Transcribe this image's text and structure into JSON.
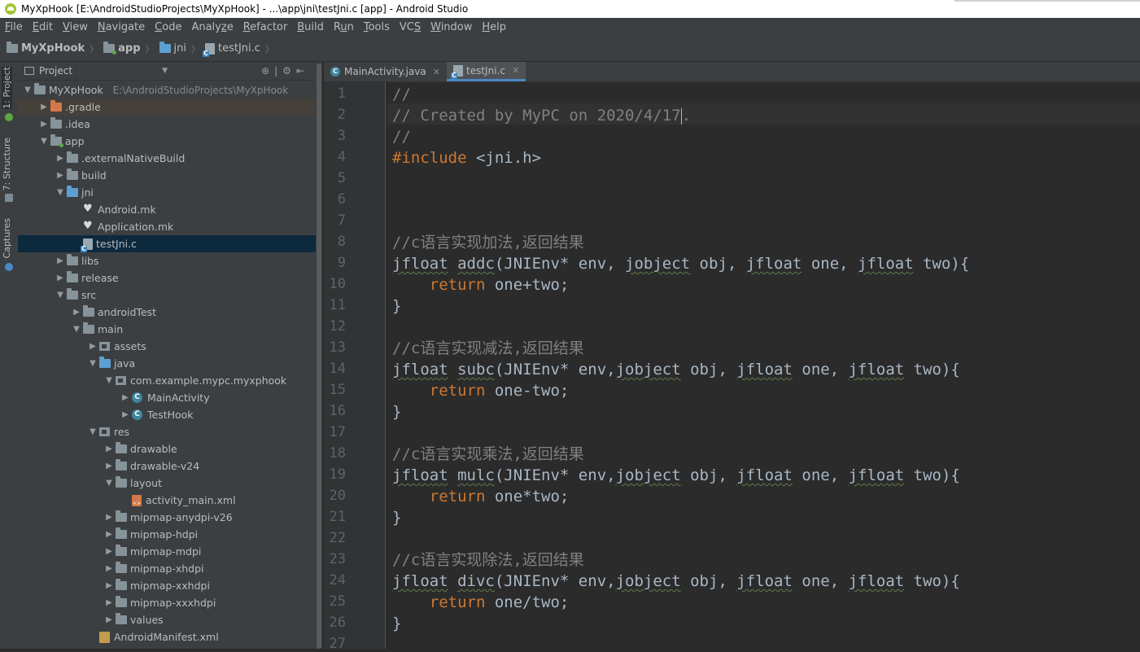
{
  "title": "MyXpHook [E:\\AndroidStudioProjects\\MyXpHook] - ...\\app\\jni\\testJni.c [app] - Android Studio",
  "menu": [
    {
      "key": "F",
      "rest": "ile"
    },
    {
      "key": "E",
      "rest": "dit"
    },
    {
      "key": "V",
      "rest": "iew"
    },
    {
      "key": "N",
      "rest": "avigate"
    },
    {
      "key": "C",
      "rest": "ode"
    },
    {
      "key": "",
      "rest": "Analy",
      "key2": "z",
      "rest2": "e"
    },
    {
      "key": "R",
      "rest": "efactor"
    },
    {
      "key": "B",
      "rest": "uild"
    },
    {
      "key": "",
      "rest": "R",
      "key2": "u",
      "rest2": "n"
    },
    {
      "key": "T",
      "rest": "ools"
    },
    {
      "key": "",
      "rest": "VC",
      "key2": "S",
      "rest2": ""
    },
    {
      "key": "W",
      "rest": "indow"
    },
    {
      "key": "H",
      "rest": "elp"
    }
  ],
  "breadcrumb": [
    "MyXpHook",
    "app",
    "jni",
    "testJni.c"
  ],
  "tool_windows": {
    "project": "1: Project",
    "structure": "7: Structure",
    "captures": "Captures"
  },
  "project_panel": {
    "title": "Project",
    "root_label": "MyXpHook",
    "root_path": "E:\\AndroidStudioProjects\\MyXpHook",
    "tree": [
      {
        "label": ".gradle"
      },
      {
        "label": ".idea"
      },
      {
        "label": "app"
      },
      {
        "label": ".externalNativeBuild"
      },
      {
        "label": "build"
      },
      {
        "label": "jni"
      },
      {
        "label": "Android.mk"
      },
      {
        "label": "Application.mk"
      },
      {
        "label": "testJni.c"
      },
      {
        "label": "libs"
      },
      {
        "label": "release"
      },
      {
        "label": "src"
      },
      {
        "label": "androidTest"
      },
      {
        "label": "main"
      },
      {
        "label": "assets"
      },
      {
        "label": "java"
      },
      {
        "label": "com.example.mypc.myxphook"
      },
      {
        "label": "MainActivity"
      },
      {
        "label": "TestHook"
      },
      {
        "label": "res"
      },
      {
        "label": "drawable"
      },
      {
        "label": "drawable-v24"
      },
      {
        "label": "layout"
      },
      {
        "label": "activity_main.xml"
      },
      {
        "label": "mipmap-anydpi-v26"
      },
      {
        "label": "mipmap-hdpi"
      },
      {
        "label": "mipmap-mdpi"
      },
      {
        "label": "mipmap-xhdpi"
      },
      {
        "label": "mipmap-xxhdpi"
      },
      {
        "label": "mipmap-xxxhdpi"
      },
      {
        "label": "values"
      },
      {
        "label": "AndroidManifest.xml"
      }
    ]
  },
  "tabs": [
    {
      "label": "MainActivity.java",
      "active": false
    },
    {
      "label": "testJni.c",
      "active": true
    }
  ],
  "editor": {
    "line_numbers": [
      "1",
      "2",
      "3",
      "4",
      "5",
      "6",
      "7",
      "8",
      "9",
      "10",
      "11",
      "12",
      "13",
      "14",
      "15",
      "16",
      "17",
      "18",
      "19",
      "20",
      "21",
      "22",
      "23",
      "24",
      "25",
      "26",
      "27"
    ],
    "comments": {
      "l1": "//",
      "l2a": "// Created by MyPC on 2020/4/17",
      "l2b": ".",
      "l3": "//",
      "add": "//c语言实现加法,返回结果",
      "sub": "//c语言实现减法,返回结果",
      "mul": "//c语言实现乘法,返回结果",
      "div": "//c语言实现除法,返回结果"
    },
    "include_kw": "#include",
    "include_file": " <jni.h>",
    "kw_return": "return",
    "t_jfloat": "jfloat",
    "t_jobject": "jobject",
    "fn_add": "addc",
    "fn_sub": "subc",
    "fn_mul": "mulc",
    "fn_div": "divc",
    "p_env_space": "(JNIEnv* env, ",
    "p_env_nospace": "(JNIEnv* env,",
    "p_obj": " obj, ",
    "p_one": " one, ",
    "p_two": " two){",
    "body_add": " one+two;",
    "body_sub": " one-two;",
    "body_mul": " one*two;",
    "body_div": " one/two;",
    "close_brace": "}"
  }
}
